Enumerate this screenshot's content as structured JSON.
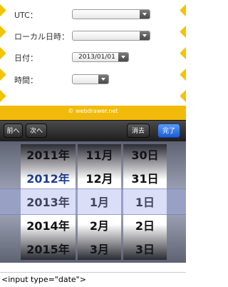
{
  "form": {
    "utc_label": "UTC：",
    "local_label": "ローカル日時：",
    "date_label": "日付：",
    "time_label": "時間：",
    "date_value": "2013/01/01"
  },
  "footer": {
    "credit": "© webdrawer.net"
  },
  "toolbar": {
    "prev_label": "前へ",
    "next_label": "次へ",
    "clear_label": "消去",
    "done_label": "完了"
  },
  "picker": {
    "years": [
      "2011年",
      "2012年",
      "2013年",
      "2014年",
      "2015年"
    ],
    "months": [
      "11月",
      "12月",
      "1月",
      "2月",
      "3月"
    ],
    "days": [
      "30日",
      "31日",
      "1日",
      "2日",
      "3日"
    ],
    "selected_index": 2
  },
  "caption": "<input type=\"date\">",
  "colors": {
    "brand_yellow": "#f2bb0b",
    "done_blue": "#1d5ed8",
    "selected_text": "#1d3f99"
  }
}
